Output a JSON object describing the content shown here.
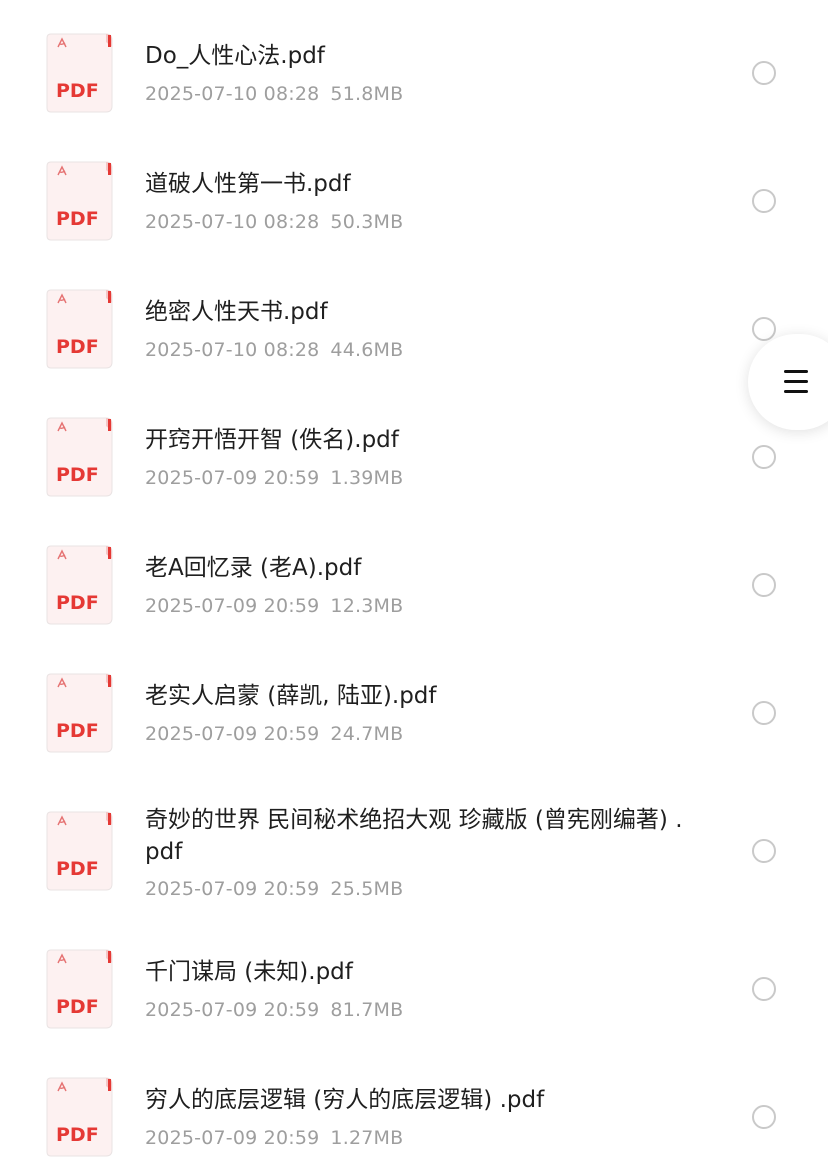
{
  "colors": {
    "accent": "#e53935",
    "name_text": "#1f1f1f",
    "meta_text": "#9e9e9e",
    "radio_border": "#c9c9c9"
  },
  "icons": {
    "file": "pdf-file-icon",
    "select": "radio-unchecked-icon",
    "menu": "hamburger-menu-icon"
  },
  "pdf_badge": "PDF",
  "files": [
    {
      "name": "Do_人性心法.pdf",
      "date": "2025-07-10 08:28",
      "size": "51.8MB"
    },
    {
      "name": "道破人性第一书.pdf",
      "date": "2025-07-10 08:28",
      "size": "50.3MB"
    },
    {
      "name": "绝密人性天书.pdf",
      "date": "2025-07-10 08:28",
      "size": "44.6MB"
    },
    {
      "name": "开窍开悟开智 (佚名).pdf",
      "date": "2025-07-09 20:59",
      "size": "1.39MB"
    },
    {
      "name": "老A回忆录 (老A).pdf",
      "date": "2025-07-09 20:59",
      "size": "12.3MB"
    },
    {
      "name": "老实人启蒙 (薛凯, 陆亚).pdf",
      "date": "2025-07-09 20:59",
      "size": "24.7MB"
    },
    {
      "name": "奇妙的世界 民间秘术绝招大观 珍藏版 (曾宪刚编著) .pdf",
      "date": "2025-07-09 20:59",
      "size": "25.5MB"
    },
    {
      "name": "千门谋局 (未知).pdf",
      "date": "2025-07-09 20:59",
      "size": "81.7MB"
    },
    {
      "name": "穷人的底层逻辑 (穷人的底层逻辑) .pdf",
      "date": "2025-07-09 20:59",
      "size": "1.27MB"
    }
  ]
}
